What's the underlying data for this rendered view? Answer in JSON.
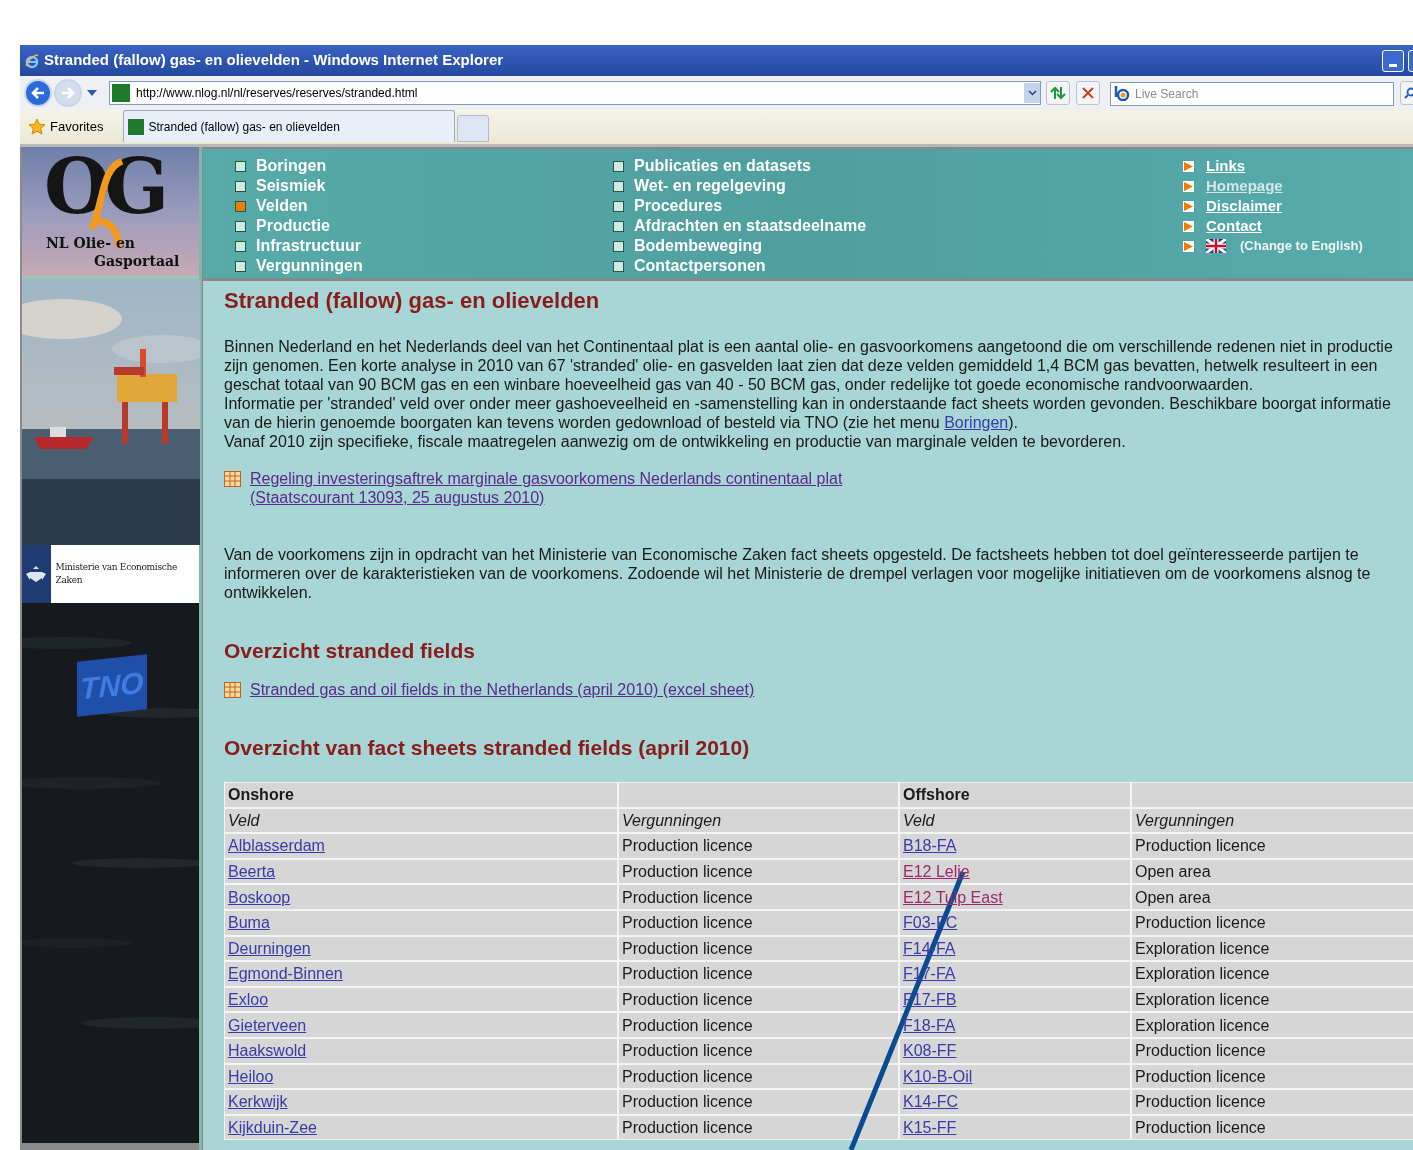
{
  "window": {
    "title": "Stranded (fallow) gas- en olievelden - Windows Internet Explorer"
  },
  "toolbar": {
    "address": "http://www.nlog.nl/nl/reserves/reserves/stranded.html",
    "search_placeholder": "Live Search"
  },
  "favorites": "Favorites",
  "tabs": [
    {
      "label": "Stranded (fallow) gas- en olievelden",
      "selected": true
    }
  ],
  "logo": {
    "letters": "OG",
    "caption_1": "NL Olie- en",
    "caption_2": "Gasportaal"
  },
  "ministry": "Ministerie van Economische Zaken",
  "partner_logo": "TNO",
  "nav": {
    "columns": [
      [
        {
          "label": "Boringen",
          "selected": false
        },
        {
          "label": "Seismiek",
          "selected": false
        },
        {
          "label": "Velden",
          "selected": true
        },
        {
          "label": "Productie",
          "selected": false
        },
        {
          "label": "Infrastructuur",
          "selected": false
        },
        {
          "label": "Vergunningen",
          "selected": false
        }
      ],
      [
        {
          "label": "Publicaties en datasets",
          "selected": false
        },
        {
          "label": "Wet- en regelgeving",
          "selected": false
        },
        {
          "label": "Procedures",
          "selected": false
        },
        {
          "label": "Afdrachten en staatsdeelname",
          "selected": false
        },
        {
          "label": "Bodembeweging",
          "selected": false
        },
        {
          "label": "Contactpersonen",
          "selected": false
        }
      ]
    ]
  },
  "side_links": [
    {
      "label": "Links",
      "kind": "link",
      "visited": false
    },
    {
      "label": "Homepage",
      "kind": "link",
      "visited": true
    },
    {
      "label": "Disclaimer",
      "kind": "link",
      "visited": false
    },
    {
      "label": "Contact",
      "kind": "link",
      "visited": false
    },
    {
      "label": "(Change to English)",
      "kind": "flag",
      "visited": false
    }
  ],
  "content": {
    "title": "Stranded (fallow) gas- en olievelden",
    "intro": [
      [
        {
          "text": "Binnen Nederland en het Nederlands deel van het Continentaal plat is een aantal olie- en gasvoorkomens aangetoond die om verschillende redenen niet in productie zijn genomen. Een korte analyse in 2010 van 67 'stranded' olie- en gasvelden laat zien dat deze velden gemiddeld 1,4 BCM gas bevatten, hetwelk resulteert in een geschat totaal van 90 BCM gas en een winbare hoeveelheid gas van 40 - 50 BCM gas, onder redelijke tot goede economische randvoorwaarden."
        }
      ],
      [
        {
          "text": "Informatie per 'stranded' veld over onder meer gashoeveelheid en -samenstelling kan in onderstaande fact sheets worden gevonden. Beschikbare boorgat informatie van de hierin genoemde boorgaten kan tevens worden gedownload of besteld via TNO (zie het menu "
        },
        {
          "link": "Boringen"
        },
        {
          "text": ")."
        }
      ],
      [
        {
          "text": "Vanaf 2010 zijn specifieke, fiscale maatregelen aanwezig om de ontwikkeling en productie van marginale velden te bevorderen."
        }
      ]
    ],
    "document_link": {
      "lines": [
        "Regeling investeringsaftrek marginale gasvoorkomens Nederlands continentaal plat",
        "(Staatscourant 13093, 25 augustus 2010)"
      ]
    },
    "factsheet_text": "Van de voorkomens zijn in opdracht van het Ministerie van Economische Zaken fact sheets opgesteld. De factsheets hebben tot doel geïnteresseerde partijen te informeren over de karakteristieken van de voorkomens. Zodoende wil het Ministerie de drempel verlagen voor mogelijke initiatieven om de voorkomens alsnog te ontwikkelen.",
    "overview_heading": "Overzicht stranded fields",
    "excel_link": "Stranded gas and oil fields in the Netherlands (april 2010) (excel sheet)",
    "factsheets_heading": "Overzicht van fact sheets stranded fields (april 2010)"
  },
  "table": {
    "onshore_heading": "Onshore",
    "offshore_heading": "Offshore",
    "columns": [
      "Veld",
      "Vergunningen",
      "Veld",
      "Vergunningen"
    ],
    "rows": [
      {
        "onshore_field": "Alblasserdam",
        "onshore_licence": "Production licence",
        "offshore_field": "B18-FA",
        "offshore_licence": "Production licence",
        "offshore_visited": false
      },
      {
        "onshore_field": "Beerta",
        "onshore_licence": "Production licence",
        "offshore_field": "E12 Lelie",
        "offshore_licence": "Open area",
        "offshore_visited": true
      },
      {
        "onshore_field": "Boskoop",
        "onshore_licence": "Production licence",
        "offshore_field": "E12 Tulp East",
        "offshore_licence": "Open area",
        "offshore_visited": true
      },
      {
        "onshore_field": "Buma",
        "onshore_licence": "Production licence",
        "offshore_field": "F03-FC",
        "offshore_licence": "Production licence",
        "offshore_visited": false
      },
      {
        "onshore_field": "Deurningen",
        "onshore_licence": "Production licence",
        "offshore_field": "F14-FA",
        "offshore_licence": "Exploration licence",
        "offshore_visited": false
      },
      {
        "onshore_field": "Egmond-Binnen",
        "onshore_licence": "Production licence",
        "offshore_field": "F17-FA",
        "offshore_licence": "Exploration licence",
        "offshore_visited": false
      },
      {
        "onshore_field": "Exloo",
        "onshore_licence": "Production licence",
        "offshore_field": "F17-FB",
        "offshore_licence": "Exploration licence",
        "offshore_visited": false
      },
      {
        "onshore_field": "Gieterveen",
        "onshore_licence": "Production licence",
        "offshore_field": "F18-FA",
        "offshore_licence": "Exploration licence",
        "offshore_visited": false
      },
      {
        "onshore_field": "Haakswold",
        "onshore_licence": "Production licence",
        "offshore_field": "K08-FF",
        "offshore_licence": "Production licence",
        "offshore_visited": false
      },
      {
        "onshore_field": "Heiloo",
        "onshore_licence": "Production licence",
        "offshore_field": "K10-B-Oil",
        "offshore_licence": "Production licence",
        "offshore_visited": false
      },
      {
        "onshore_field": "Kerkwijk",
        "onshore_licence": "Production licence",
        "offshore_field": "K14-FC",
        "offshore_licence": "Production licence",
        "offshore_visited": false
      },
      {
        "onshore_field": "Kijkduin-Zee",
        "onshore_licence": "Production licence",
        "offshore_field": "K15-FF",
        "offshore_licence": "Production licence",
        "offshore_visited": false
      }
    ]
  }
}
